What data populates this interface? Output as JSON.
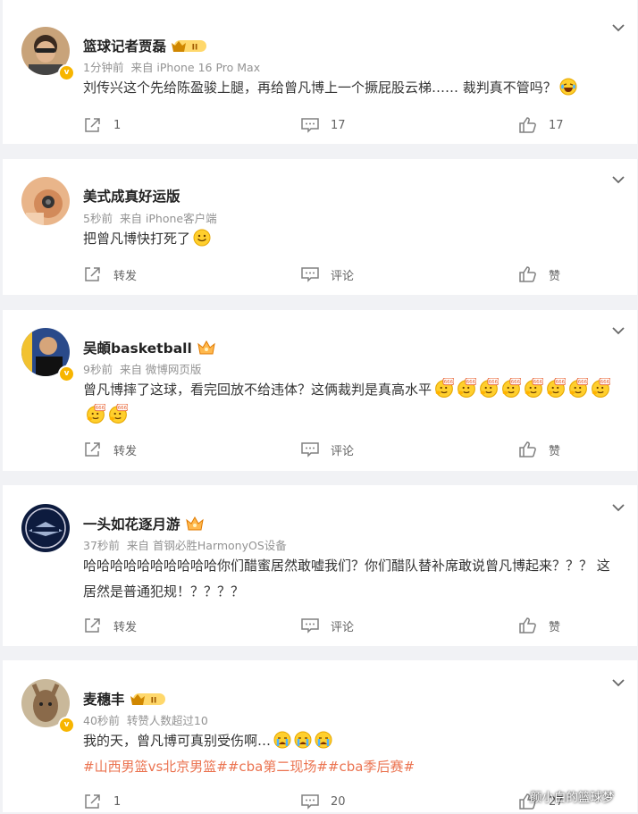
{
  "comments": [
    {
      "username": "篮球记者贾磊",
      "meta": [
        "1分钟前",
        "来自 iPhone 16 Pro Max"
      ],
      "text": "刘传兴这个先给陈盈骏上腿，再给曾凡博上一个撅屁股云梯…… 裁判真不管吗？",
      "emojis": [
        "laugh-cry"
      ],
      "actions": [
        "1",
        "17",
        "17"
      ],
      "user_badge": "level-ii"
    },
    {
      "username": "美式成真好运版",
      "meta": [
        "5秒前",
        "来自 iPhone客户端"
      ],
      "text": "把曾凡博快打死了",
      "emojis": [
        "smile"
      ],
      "actions": [
        "转发",
        "评论",
        "赞"
      ]
    },
    {
      "username": "吴頔basketball",
      "meta": [
        "9秒前",
        "来自 微博网页版"
      ],
      "text": "曾凡博摔了这球，看完回放不给违体？这俩裁判是真高水平",
      "emojis": [
        "666",
        "666",
        "666",
        "666",
        "666",
        "666",
        "666",
        "666",
        "666",
        "666"
      ],
      "actions": [
        "转发",
        "评论",
        "赞"
      ],
      "user_badge": "crown"
    },
    {
      "username": "一头如花逐月游",
      "meta": [
        "37秒前",
        "来自 首钢必胜HarmonyOS设备"
      ],
      "text": "哈哈哈哈哈哈哈哈哈哈你们醋蜜居然敢嘘我们？你们醋队替补席敢说曾凡博起来？？？ 这居然是普通犯规！？？？？",
      "actions": [
        "转发",
        "评论",
        "赞"
      ],
      "user_badge": "crown"
    },
    {
      "username": "麦穗丰",
      "meta": [
        "40秒前",
        "转赞人数超过10"
      ],
      "text": "我的天，曾凡博可真别受伤啊…",
      "emojis": [
        "cry",
        "cry",
        "cry"
      ],
      "hashtags": "#山西男篮vs北京男篮##cba第二现场##cba季后赛#",
      "actions": [
        "1",
        "20",
        "27"
      ],
      "user_badge": "level-ii"
    }
  ],
  "watermark": "颜小白的篮球梦",
  "colors": {
    "hashtag": "#eb7350",
    "badge": "#f7b500",
    "meta": "#939393",
    "bg": "#f1f2f5"
  },
  "icons": {
    "forward": "share-icon",
    "comment": "comment-icon",
    "like": "thumb-up-icon",
    "more": "chevron-down-icon"
  }
}
